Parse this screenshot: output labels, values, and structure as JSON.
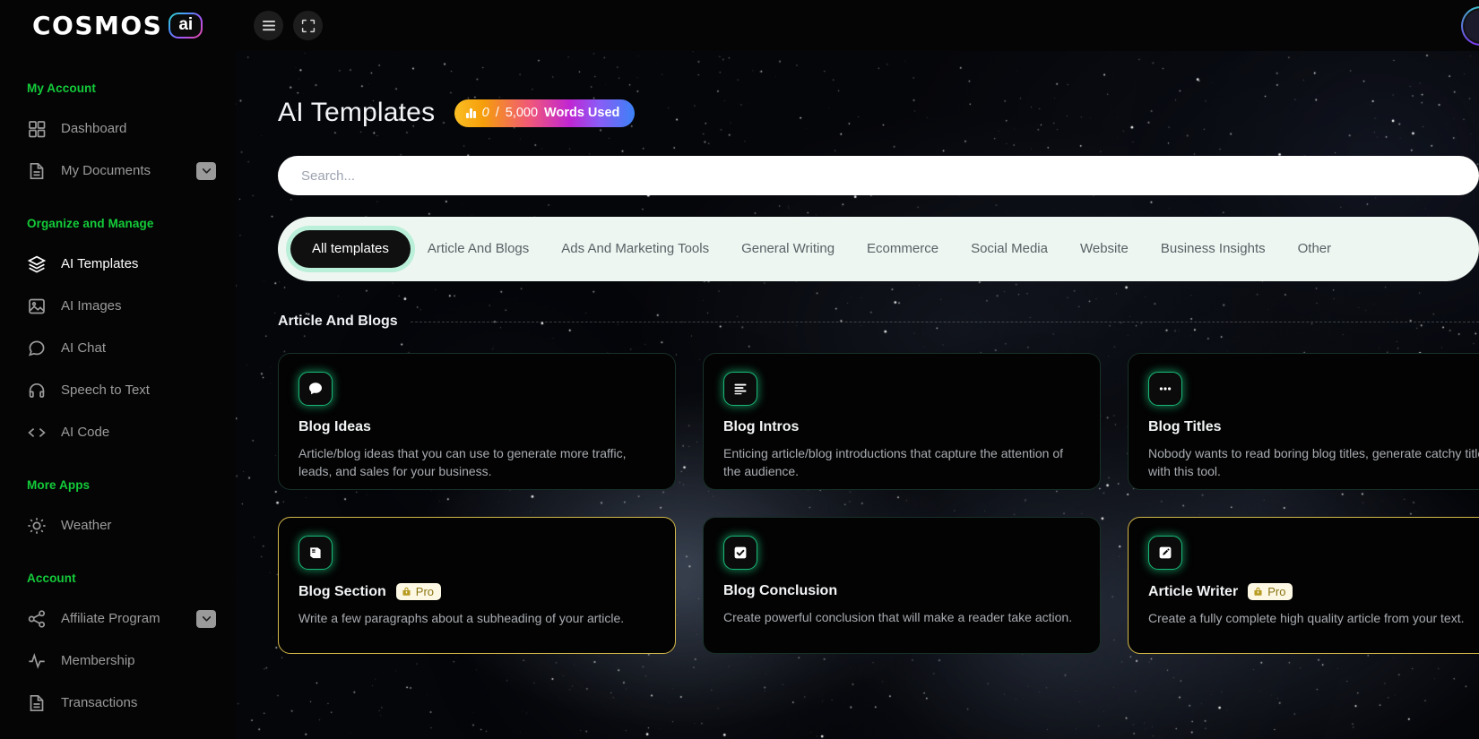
{
  "brand": {
    "name": "COSMOS",
    "suffix": "ai"
  },
  "topbar": {
    "menu_icon": "hamburger-menu-icon",
    "fullscreen_icon": "fullscreen-icon"
  },
  "sidebar": {
    "groups": [
      {
        "title": "My Account",
        "items": [
          {
            "label": "Dashboard",
            "icon": "grid-icon",
            "active": false,
            "caret": false
          },
          {
            "label": "My Documents",
            "icon": "document-icon",
            "active": false,
            "caret": true
          }
        ]
      },
      {
        "title": "Organize and Manage",
        "items": [
          {
            "label": "AI Templates",
            "icon": "layers-icon",
            "active": true,
            "caret": false
          },
          {
            "label": "AI Images",
            "icon": "image-icon",
            "active": false,
            "caret": false
          },
          {
            "label": "AI Chat",
            "icon": "chat-bubble-icon",
            "active": false,
            "caret": false
          },
          {
            "label": "Speech to Text",
            "icon": "headphones-icon",
            "active": false,
            "caret": false
          },
          {
            "label": "AI Code",
            "icon": "code-brackets-icon",
            "active": false,
            "caret": false
          }
        ]
      },
      {
        "title": "More Apps",
        "items": [
          {
            "label": "Weather",
            "icon": "sun-icon",
            "active": false,
            "caret": false
          }
        ]
      },
      {
        "title": "Account",
        "items": [
          {
            "label": "Affiliate Program",
            "icon": "share-nodes-icon",
            "active": false,
            "caret": true
          },
          {
            "label": "Membership",
            "icon": "activity-pulse-icon",
            "active": false,
            "caret": false
          },
          {
            "label": "Transactions",
            "icon": "document-icon",
            "active": false,
            "caret": false
          }
        ]
      }
    ]
  },
  "page": {
    "title": "AI Templates",
    "words_badge": {
      "icon": "bar-chart-icon",
      "used": "0",
      "separator": "/",
      "total": "5,000",
      "label": "Words Used"
    }
  },
  "search": {
    "placeholder": "Search...",
    "value": ""
  },
  "tabs": [
    {
      "label": "All templates",
      "active": true
    },
    {
      "label": "Article And Blogs",
      "active": false
    },
    {
      "label": "Ads And Marketing Tools",
      "active": false
    },
    {
      "label": "General Writing",
      "active": false
    },
    {
      "label": "Ecommerce",
      "active": false
    },
    {
      "label": "Social Media",
      "active": false
    },
    {
      "label": "Website",
      "active": false
    },
    {
      "label": "Business Insights",
      "active": false
    },
    {
      "label": "Other",
      "active": false
    }
  ],
  "sections": [
    {
      "title": "Article And Blogs",
      "cards": [
        {
          "title": "Blog Ideas",
          "description": "Article/blog ideas that you can use to generate more traffic, leads, and sales for your business.",
          "icon": "chat-bubble-filled-icon",
          "pro": false
        },
        {
          "title": "Blog Intros",
          "description": "Enticing article/blog introductions that capture the attention of the audience.",
          "icon": "text-lines-icon",
          "pro": false
        },
        {
          "title": "Blog Titles",
          "description": "Nobody wants to read boring blog titles, generate catchy titles with this tool.",
          "icon": "ellipsis-icon",
          "pro": false
        },
        {
          "title": "Blog Section",
          "description": "Write a few paragraphs about a subheading of your article.",
          "icon": "book-icon",
          "pro": true
        },
        {
          "title": "Blog Conclusion",
          "description": "Create powerful conclusion that will make a reader take action.",
          "icon": "checkbox-checked-icon",
          "pro": false
        },
        {
          "title": "Article Writer",
          "description": "Create a fully complete high quality article from your text.",
          "icon": "pencil-square-icon",
          "pro": true
        }
      ]
    }
  ],
  "pro_badge_label": "Pro",
  "colors": {
    "accent_green": "#14cc3a",
    "card_border": "rgba(110,231,183,0.20)",
    "pro_border": "#d4b84a",
    "tabs_bg": "#edf6f1"
  }
}
